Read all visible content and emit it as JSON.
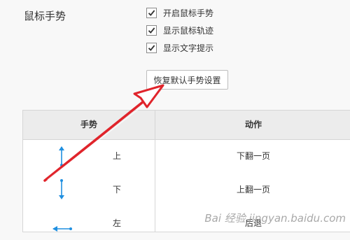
{
  "section": {
    "title": "鼠标手势"
  },
  "options": [
    {
      "label": "开启鼠标手势",
      "checked": true
    },
    {
      "label": "显示鼠标轨迹",
      "checked": true
    },
    {
      "label": "显示文字提示",
      "checked": true
    }
  ],
  "reset_button": {
    "label": "恢复默认手势设置"
  },
  "table": {
    "headers": {
      "gesture": "手势",
      "action": "动作"
    },
    "rows": [
      {
        "icon": "up-down-arrow-icon",
        "direction": "上",
        "action": "下翻一页"
      },
      {
        "icon": "down-up-arrow-icon",
        "direction": "下",
        "action": "上翻一页"
      },
      {
        "icon": "left-arrow-icon",
        "direction": "左",
        "action": "后退"
      }
    ]
  },
  "annotation": {
    "arrow_color": "#e0242b"
  },
  "watermark": {
    "text": "Bai 经验 jingyan.baidu.com"
  },
  "colors": {
    "gesture_icon": "#1f8fe0",
    "header_bg": "#ececec"
  }
}
